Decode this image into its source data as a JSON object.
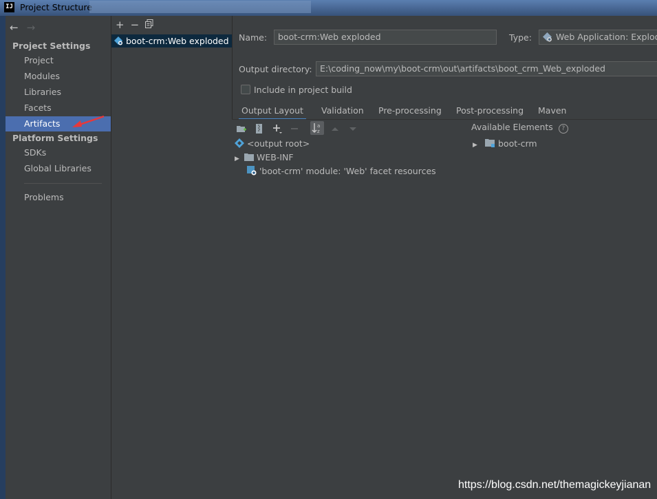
{
  "window": {
    "title": "Project Structure",
    "app_logo_text": "IJ"
  },
  "sidebar": {
    "project_settings_header": "Project Settings",
    "items": [
      {
        "label": "Project"
      },
      {
        "label": "Modules"
      },
      {
        "label": "Libraries"
      },
      {
        "label": "Facets"
      },
      {
        "label": "Artifacts",
        "selected": true
      }
    ],
    "platform_settings_header": "Platform Settings",
    "platform_items": [
      {
        "label": "SDKs"
      },
      {
        "label": "Global Libraries"
      }
    ],
    "problems_label": "Problems"
  },
  "artifacts_list": {
    "toolbar": {
      "add": "+",
      "remove": "−",
      "copy": "copy-icon"
    },
    "items": [
      {
        "label": "boot-crm:Web exploded",
        "selected": true
      }
    ]
  },
  "artifact": {
    "name_label": "Name:",
    "name_value": "boot-crm:Web exploded",
    "type_label": "Type:",
    "type_value": "Web Application: Exploded",
    "output_dir_label": "Output directory:",
    "output_dir_value": "E:\\coding_now\\my\\boot-crm\\out\\artifacts\\boot_crm_Web_exploded",
    "include_in_build_label": "Include in project build",
    "include_in_build_checked": false
  },
  "tabs": [
    {
      "label": "Output Layout",
      "active": true
    },
    {
      "label": "Validation"
    },
    {
      "label": "Pre-processing"
    },
    {
      "label": "Post-processing"
    },
    {
      "label": "Maven"
    }
  ],
  "output_tree": [
    {
      "label": "<output root>"
    },
    {
      "label": "WEB-INF"
    },
    {
      "label": "'boot-crm' module: 'Web' facet resources"
    }
  ],
  "available_elements": {
    "title": "Available Elements",
    "help_glyph": "?",
    "items": [
      {
        "label": "boot-crm"
      }
    ]
  },
  "watermark": "https://blog.csdn.net/themagickeyjianan",
  "colors": {
    "background": "#3c3f41",
    "selection_sidebar": "#4b6eaf",
    "selection_list": "#0d293e",
    "tab_active_underline": "#4a88c7",
    "annotation_arrow": "#e8383a"
  }
}
